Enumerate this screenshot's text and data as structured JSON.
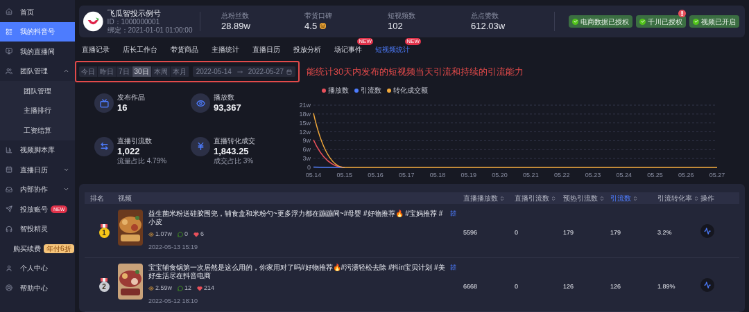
{
  "sidebar": {
    "items": [
      {
        "label": "首页",
        "selected": false
      },
      {
        "label": "我的抖音号",
        "selected": true
      },
      {
        "label": "我的直播间",
        "selected": false
      },
      {
        "label": "团队管理",
        "selected": false,
        "expanded": true,
        "children": [
          {
            "label": "团队管理"
          },
          {
            "label": "主播排行"
          },
          {
            "label": "工资结算"
          }
        ]
      },
      {
        "label": "视频脚本库",
        "selected": false
      },
      {
        "label": "直播日历",
        "selected": false,
        "expanded": false
      },
      {
        "label": "内部协作",
        "selected": false,
        "expanded": false
      },
      {
        "label": "投放账号",
        "selected": false,
        "badge": {
          "kind": "new",
          "text": "NEW"
        }
      },
      {
        "label": "智投精灵",
        "selected": false
      },
      {
        "label": "购买续费",
        "selected": false,
        "badge": {
          "kind": "promo",
          "text": "年付6折"
        }
      },
      {
        "label": "个人中心",
        "selected": false
      },
      {
        "label": "帮助中心",
        "selected": false
      }
    ]
  },
  "account": {
    "name": "飞瓜智投示例号",
    "id": "ID：1000000001",
    "bound": "绑定：2021-01-01 01:00:00"
  },
  "stats": [
    {
      "label": "总粉丝数",
      "value": "28.89w"
    },
    {
      "label": "带货口碑",
      "value": "4.5",
      "shop_badge": true
    },
    {
      "label": "短视频数",
      "value": "102"
    },
    {
      "label": "总点赞数",
      "value": "612.03w"
    }
  ],
  "auth_buttons": [
    {
      "label": "电商数据已授权",
      "alert": false
    },
    {
      "label": "千川已授权",
      "alert": true
    },
    {
      "label": "视频已开启",
      "alert": false
    }
  ],
  "tabs": [
    {
      "label": "直播记录",
      "selected": false
    },
    {
      "label": "店长工作台",
      "selected": false
    },
    {
      "label": "带货商品",
      "selected": false
    },
    {
      "label": "主播统计",
      "selected": false
    },
    {
      "label": "直播日历",
      "selected": false
    },
    {
      "label": "投放分析",
      "selected": false
    },
    {
      "label": "场记事件",
      "selected": false,
      "badge": "NEW"
    },
    {
      "label": "短视频统计",
      "selected": true,
      "badge": "NEW"
    }
  ],
  "filter": {
    "ranges": [
      {
        "label": "今日",
        "selected": false
      },
      {
        "label": "昨日",
        "selected": false
      },
      {
        "label": "7日",
        "selected": false
      },
      {
        "label": "30日",
        "selected": true
      },
      {
        "label": "本周",
        "selected": false
      },
      {
        "label": "本月",
        "selected": false
      }
    ],
    "start": "2022-05-14",
    "end": "2022-05-27"
  },
  "annotation": "能统计30天内发布的短视频当天引流和持续的引流能力",
  "metrics": [
    {
      "label": "发布作品",
      "value": "16"
    },
    {
      "label": "播放数",
      "value": "93,367"
    },
    {
      "label": "直播引流数",
      "value": "1,022",
      "note": "流量占比 4.79%"
    },
    {
      "label": "直播转化成交",
      "value": "1,843.25",
      "note": "成交占比 3%"
    }
  ],
  "chart_data": {
    "type": "line",
    "categories": [
      "05.14",
      "05.15",
      "05.16",
      "05.17",
      "05.18",
      "05.19",
      "05.20",
      "05.21",
      "05.22",
      "05.23",
      "05.24",
      "05.25",
      "05.26",
      "05.27"
    ],
    "series": [
      {
        "name": "播放数",
        "color": "#e8505b",
        "values": [
          9.3,
          0,
          null,
          null,
          null,
          null,
          null,
          null,
          null,
          null,
          null,
          null,
          null,
          null
        ]
      },
      {
        "name": "引流数",
        "color": "#4d7cfe",
        "values": [
          0.1,
          0,
          null,
          null,
          null,
          null,
          null,
          null,
          null,
          null,
          null,
          null,
          null,
          null
        ]
      },
      {
        "name": "转化成交额",
        "color": "#f2a93b",
        "values": [
          18.3,
          0,
          0,
          0,
          0,
          0,
          0,
          0,
          0,
          0,
          0,
          0,
          0,
          0
        ]
      }
    ],
    "ylim": [
      0,
      21
    ],
    "grid": true,
    "yticks": [
      {
        "value": 0,
        "label": "0"
      },
      {
        "value": 3,
        "label": "3w"
      },
      {
        "value": 6,
        "label": "6w"
      },
      {
        "value": 9,
        "label": "9w"
      },
      {
        "value": 12,
        "label": "12w"
      },
      {
        "value": 15,
        "label": "15w"
      },
      {
        "value": 18,
        "label": "18w"
      },
      {
        "value": 21,
        "label": "21w"
      }
    ]
  },
  "table": {
    "columns": [
      {
        "label": "排名",
        "sortable": false,
        "active": false
      },
      {
        "label": "视频",
        "sortable": false,
        "active": false
      },
      {
        "label": "直播播放数",
        "sortable": true,
        "active": false
      },
      {
        "label": "直播引流数",
        "sortable": true,
        "active": false
      },
      {
        "label": "预热引流数",
        "sortable": true,
        "active": false
      },
      {
        "label": "引流数",
        "sortable": true,
        "active": true
      },
      {
        "label": "引流转化率",
        "sortable": true,
        "active": false
      },
      {
        "label": "操作",
        "sortable": false,
        "active": false
      }
    ],
    "rows": [
      {
        "rank": "1",
        "color": "#f5c518",
        "title": "益生菌米粉送硅胶围兜，辅食盒和米粉勺~更多浮力都在蹦蹦间~#母婴 #好物推荐🔥 #宝妈推荐 #小皮",
        "views": "1.07w",
        "comments": "0",
        "likes": "6",
        "published": "2022-05-13 15:19",
        "live_plays": "5596",
        "live_traffic": "0",
        "warmup_traffic": "179",
        "traffic": "179",
        "conversion_rate": "3.2%"
      },
      {
        "rank": "2",
        "color": "#c9ccd3",
        "title": "宝宝辅食锅第一次居然是这么用的，你家用对了吗#好物推荐🔥#污渍轻松去除 #抖in宝贝计划 #美好生活尽在抖音电商",
        "views": "2.59w",
        "comments": "12",
        "likes": "214",
        "published": "2022-05-12 18:10",
        "live_plays": "6668",
        "live_traffic": "0",
        "warmup_traffic": "126",
        "traffic": "126",
        "conversion_rate": "1.89%"
      }
    ]
  }
}
